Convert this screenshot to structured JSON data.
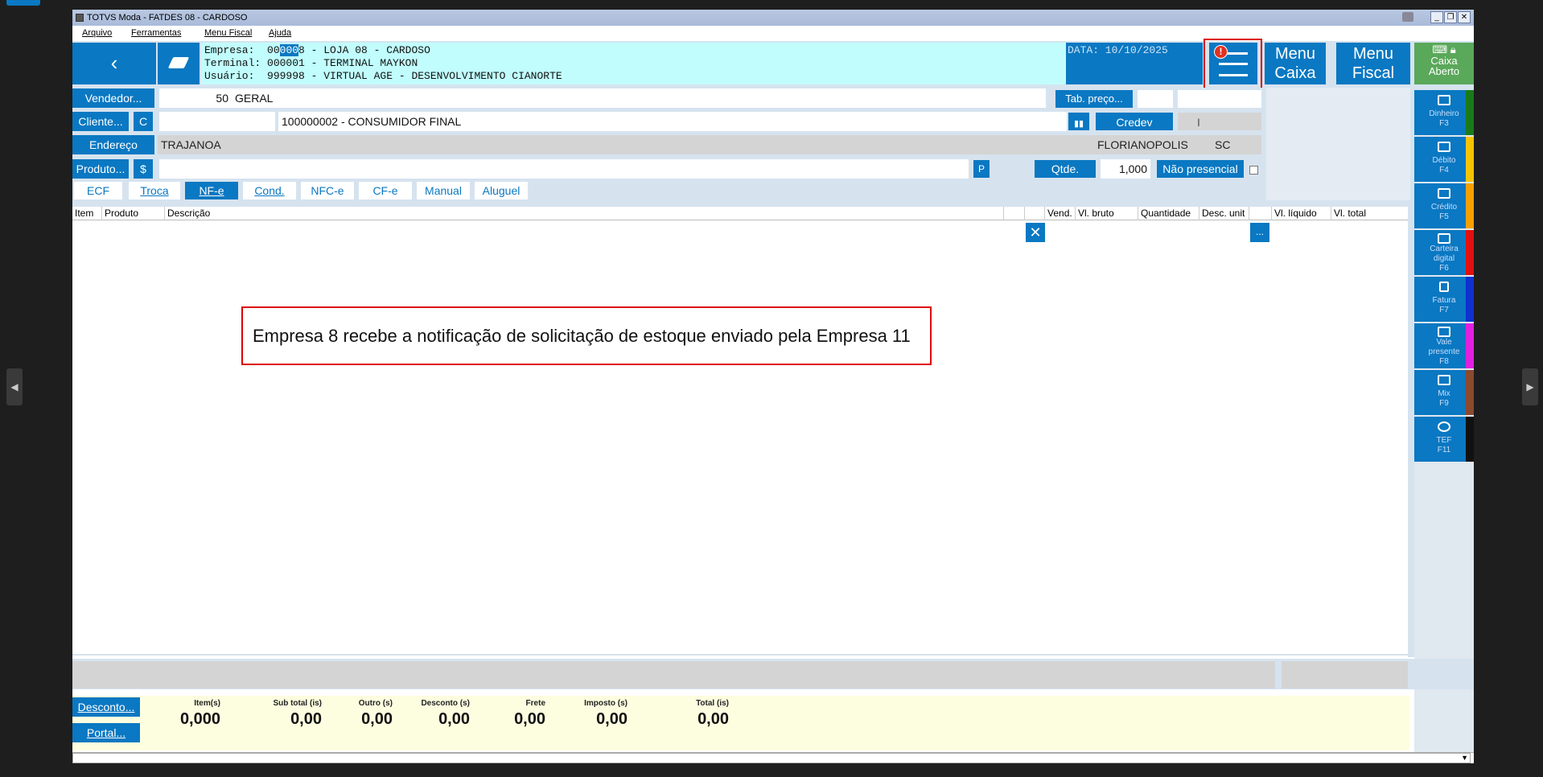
{
  "window": {
    "title": "TOTVS Moda - FATDES 08 - CARDOSO"
  },
  "menu": [
    "Arquivo",
    "Ferramentas",
    "Menu Fiscal",
    "Ajuda"
  ],
  "header": {
    "empresa_label": "Empresa:",
    "empresa_pre": "00",
    "empresa_sel": "000",
    "empresa_post": "8 - LOJA 08 - CARDOSO",
    "terminal": "Terminal: 000001 - TERMINAL MAYKON",
    "usuario": "Usuário:  999998 - VIRTUAL AGE - DESENVOLVIMENTO CIANORTE",
    "date": "DATA: 10/10/2025",
    "menu_caixa_1": "Menu",
    "menu_caixa_2": "Caixa",
    "menu_fiscal_1": "Menu",
    "menu_fiscal_2": "Fiscal",
    "caixa_1": "Caixa",
    "caixa_2": "Aberto",
    "notification_badge": "!"
  },
  "form": {
    "vendedor_btn": "Vendedor...",
    "vendedor_code": "50",
    "vendedor_name": "GERAL",
    "tab_preco_btn": "Tab. preço...",
    "cliente_btn": "Cliente...",
    "c_btn": "C",
    "cliente_name": "100000002 - CONSUMIDOR FINAL",
    "credev_btn": "Credev",
    "endereco_btn": "Endereço",
    "endereco": "TRAJANOA",
    "cidade": "FLORIANOPOLIS",
    "uf": "SC",
    "produto_btn": "Produto...",
    "dollar_btn": "$",
    "p_btn": "P",
    "qtde_btn": "Qtde.",
    "qtde_value": "1,000",
    "nao_presencial_btn": "Não presencial"
  },
  "tabs": [
    "ECF",
    "Troca",
    "NF-e",
    "Cond.",
    "NFC-e",
    "CF-e",
    "Manual",
    "Aluguel"
  ],
  "active_tab": "NF-e",
  "grid": {
    "columns": [
      "Item",
      "Produto",
      "Descrição",
      "Vend.",
      "Vl. bruto",
      "Quantidade",
      "Desc. unit",
      "Vl. líquido",
      "Vl. total"
    ],
    "ellipsis_btn": "..."
  },
  "sidebar": [
    {
      "label1": "Dinheiro",
      "label2": "F3",
      "color": "#1a7a1a"
    },
    {
      "label1": "Débito",
      "label2": "F4",
      "color": "#f5c400"
    },
    {
      "label1": "Crédito",
      "label2": "F5",
      "color": "#f5a000"
    },
    {
      "label1": "Carteira",
      "label2": "digital",
      "label3": "F6",
      "color": "#e01010"
    },
    {
      "label1": "Fatura",
      "label2": "F7",
      "color": "#1030d0"
    },
    {
      "label1": "Vale",
      "label2": "presente",
      "label3": "F8",
      "color": "#e020e0"
    },
    {
      "label1": "Mix",
      "label2": "F9",
      "color": "#8a4a30"
    },
    {
      "label1": "TEF",
      "label2": "F11",
      "color": "#111111"
    }
  ],
  "annotation": "Empresa 8 recebe a notificação de solicitação de estoque enviado pela Empresa 11",
  "footer": {
    "desconto_btn": "Desconto...",
    "portal_btn": "Portal...",
    "totals": [
      {
        "label": "Item(s)",
        "value": "0,000"
      },
      {
        "label": "Sub total (is)",
        "value": "0,00"
      },
      {
        "label": "Outro (s)",
        "value": "0,00"
      },
      {
        "label": "Desconto (s)",
        "value": "0,00"
      },
      {
        "label": "Frete",
        "value": "0,00"
      },
      {
        "label": "Imposto (s)",
        "value": "0,00"
      },
      {
        "label": "Total (is)",
        "value": "0,00"
      }
    ]
  },
  "colors": {
    "accent": "#0a78c2",
    "header_info_bg": "#c1fdfd",
    "highlight": "#d00000",
    "caixa_aberto": "#5aa85a"
  }
}
